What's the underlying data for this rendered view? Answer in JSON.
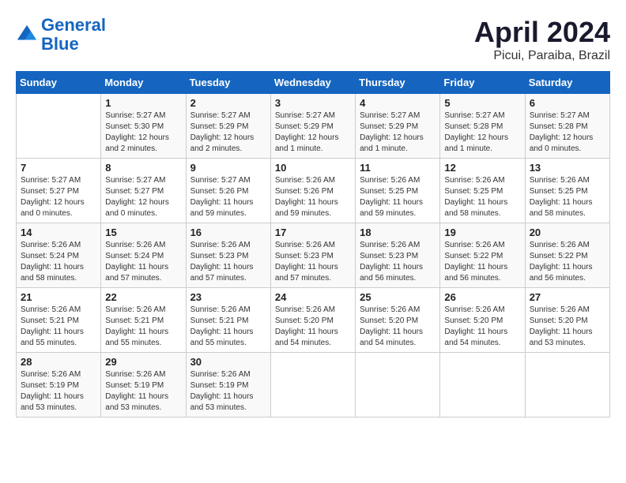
{
  "header": {
    "logo_line1": "General",
    "logo_line2": "Blue",
    "month_title": "April 2024",
    "location": "Picui, Paraiba, Brazil"
  },
  "weekdays": [
    "Sunday",
    "Monday",
    "Tuesday",
    "Wednesday",
    "Thursday",
    "Friday",
    "Saturday"
  ],
  "weeks": [
    [
      {
        "day": "",
        "info": ""
      },
      {
        "day": "1",
        "info": "Sunrise: 5:27 AM\nSunset: 5:30 PM\nDaylight: 12 hours\nand 2 minutes."
      },
      {
        "day": "2",
        "info": "Sunrise: 5:27 AM\nSunset: 5:29 PM\nDaylight: 12 hours\nand 2 minutes."
      },
      {
        "day": "3",
        "info": "Sunrise: 5:27 AM\nSunset: 5:29 PM\nDaylight: 12 hours\nand 1 minute."
      },
      {
        "day": "4",
        "info": "Sunrise: 5:27 AM\nSunset: 5:29 PM\nDaylight: 12 hours\nand 1 minute."
      },
      {
        "day": "5",
        "info": "Sunrise: 5:27 AM\nSunset: 5:28 PM\nDaylight: 12 hours\nand 1 minute."
      },
      {
        "day": "6",
        "info": "Sunrise: 5:27 AM\nSunset: 5:28 PM\nDaylight: 12 hours\nand 0 minutes."
      }
    ],
    [
      {
        "day": "7",
        "info": "Sunrise: 5:27 AM\nSunset: 5:27 PM\nDaylight: 12 hours\nand 0 minutes."
      },
      {
        "day": "8",
        "info": "Sunrise: 5:27 AM\nSunset: 5:27 PM\nDaylight: 12 hours\nand 0 minutes."
      },
      {
        "day": "9",
        "info": "Sunrise: 5:27 AM\nSunset: 5:26 PM\nDaylight: 11 hours\nand 59 minutes."
      },
      {
        "day": "10",
        "info": "Sunrise: 5:26 AM\nSunset: 5:26 PM\nDaylight: 11 hours\nand 59 minutes."
      },
      {
        "day": "11",
        "info": "Sunrise: 5:26 AM\nSunset: 5:25 PM\nDaylight: 11 hours\nand 59 minutes."
      },
      {
        "day": "12",
        "info": "Sunrise: 5:26 AM\nSunset: 5:25 PM\nDaylight: 11 hours\nand 58 minutes."
      },
      {
        "day": "13",
        "info": "Sunrise: 5:26 AM\nSunset: 5:25 PM\nDaylight: 11 hours\nand 58 minutes."
      }
    ],
    [
      {
        "day": "14",
        "info": "Sunrise: 5:26 AM\nSunset: 5:24 PM\nDaylight: 11 hours\nand 58 minutes."
      },
      {
        "day": "15",
        "info": "Sunrise: 5:26 AM\nSunset: 5:24 PM\nDaylight: 11 hours\nand 57 minutes."
      },
      {
        "day": "16",
        "info": "Sunrise: 5:26 AM\nSunset: 5:23 PM\nDaylight: 11 hours\nand 57 minutes."
      },
      {
        "day": "17",
        "info": "Sunrise: 5:26 AM\nSunset: 5:23 PM\nDaylight: 11 hours\nand 57 minutes."
      },
      {
        "day": "18",
        "info": "Sunrise: 5:26 AM\nSunset: 5:23 PM\nDaylight: 11 hours\nand 56 minutes."
      },
      {
        "day": "19",
        "info": "Sunrise: 5:26 AM\nSunset: 5:22 PM\nDaylight: 11 hours\nand 56 minutes."
      },
      {
        "day": "20",
        "info": "Sunrise: 5:26 AM\nSunset: 5:22 PM\nDaylight: 11 hours\nand 56 minutes."
      }
    ],
    [
      {
        "day": "21",
        "info": "Sunrise: 5:26 AM\nSunset: 5:21 PM\nDaylight: 11 hours\nand 55 minutes."
      },
      {
        "day": "22",
        "info": "Sunrise: 5:26 AM\nSunset: 5:21 PM\nDaylight: 11 hours\nand 55 minutes."
      },
      {
        "day": "23",
        "info": "Sunrise: 5:26 AM\nSunset: 5:21 PM\nDaylight: 11 hours\nand 55 minutes."
      },
      {
        "day": "24",
        "info": "Sunrise: 5:26 AM\nSunset: 5:20 PM\nDaylight: 11 hours\nand 54 minutes."
      },
      {
        "day": "25",
        "info": "Sunrise: 5:26 AM\nSunset: 5:20 PM\nDaylight: 11 hours\nand 54 minutes."
      },
      {
        "day": "26",
        "info": "Sunrise: 5:26 AM\nSunset: 5:20 PM\nDaylight: 11 hours\nand 54 minutes."
      },
      {
        "day": "27",
        "info": "Sunrise: 5:26 AM\nSunset: 5:20 PM\nDaylight: 11 hours\nand 53 minutes."
      }
    ],
    [
      {
        "day": "28",
        "info": "Sunrise: 5:26 AM\nSunset: 5:19 PM\nDaylight: 11 hours\nand 53 minutes."
      },
      {
        "day": "29",
        "info": "Sunrise: 5:26 AM\nSunset: 5:19 PM\nDaylight: 11 hours\nand 53 minutes."
      },
      {
        "day": "30",
        "info": "Sunrise: 5:26 AM\nSunset: 5:19 PM\nDaylight: 11 hours\nand 53 minutes."
      },
      {
        "day": "",
        "info": ""
      },
      {
        "day": "",
        "info": ""
      },
      {
        "day": "",
        "info": ""
      },
      {
        "day": "",
        "info": ""
      }
    ]
  ]
}
